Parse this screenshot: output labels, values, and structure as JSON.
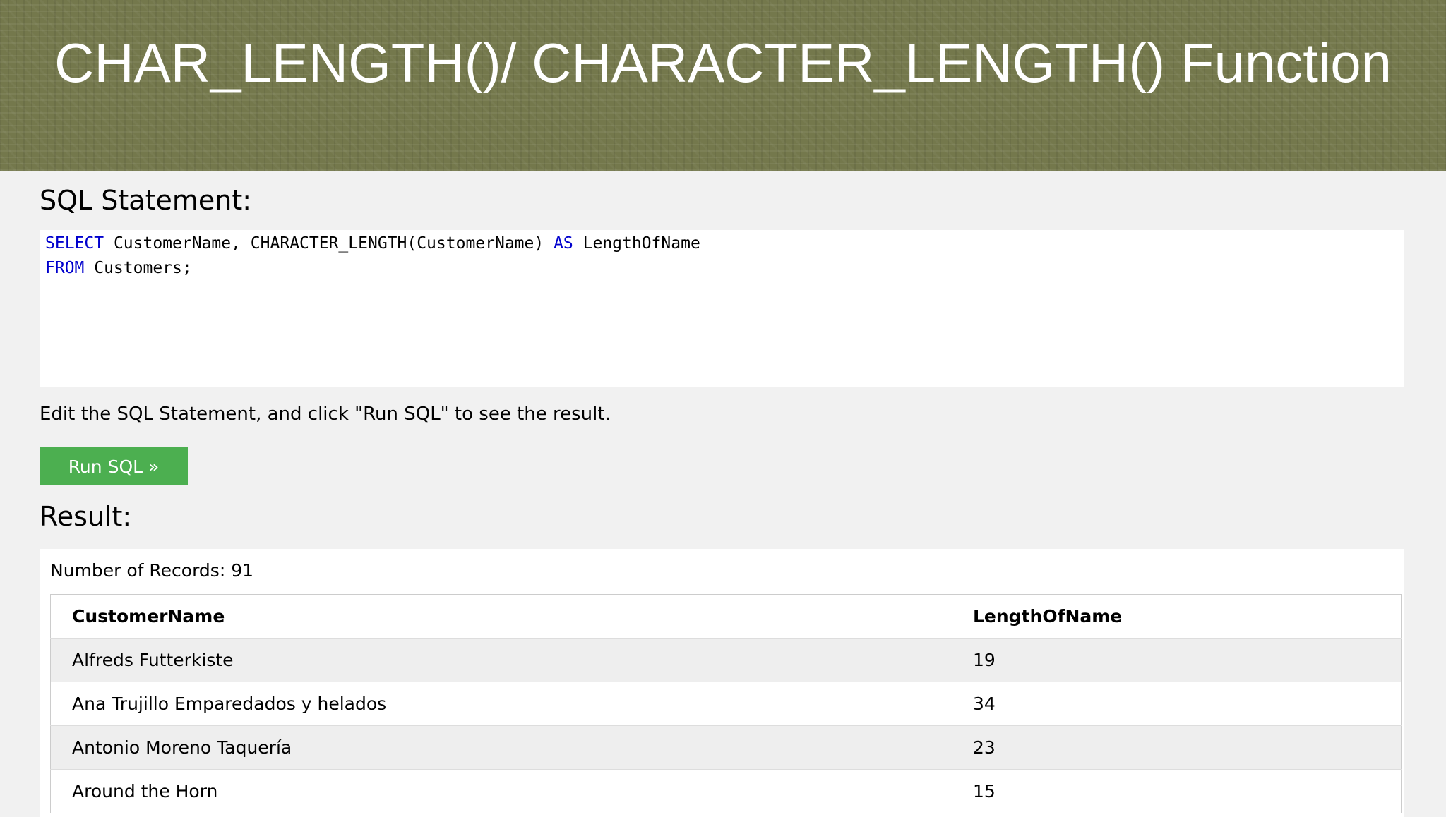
{
  "banner": {
    "title": "CHAR_LENGTH()/ CHARACTER_LENGTH() Function"
  },
  "sql_section": {
    "heading": "SQL Statement:",
    "code": {
      "line1": {
        "kw1": "SELECT",
        "part1": " CustomerName, CHARACTER_LENGTH(CustomerName) ",
        "kw2": "AS",
        "part2": " LengthOfName"
      },
      "line2": {
        "kw1": "FROM",
        "part1": " Customers;"
      }
    },
    "hint": "Edit the SQL Statement, and click \"Run SQL\" to see the result.",
    "run_button": "Run SQL »"
  },
  "result_section": {
    "heading": "Result:",
    "records_label": "Number of Records: 91",
    "columns": [
      "CustomerName",
      "LengthOfName"
    ],
    "rows": [
      [
        "Alfreds Futterkiste",
        "19"
      ],
      [
        "Ana Trujillo Emparedados y helados",
        "34"
      ],
      [
        "Antonio Moreno Taquería",
        "23"
      ],
      [
        "Around the Horn",
        "15"
      ]
    ]
  },
  "colors": {
    "banner_bg": "#74784c",
    "button_bg": "#4caf50",
    "keyword": "#0000cd"
  }
}
